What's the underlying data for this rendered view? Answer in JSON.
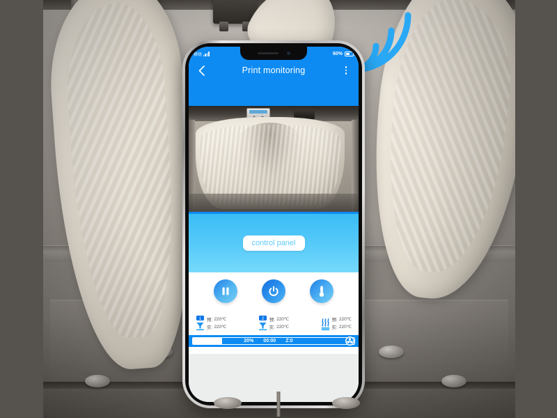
{
  "scene": {
    "description": "3D printer chamber with white printed dragon models",
    "background_bar_color": "#56524e"
  },
  "wifi": {
    "icon": "wifi-signal-icon",
    "color": "#29A8F5",
    "arc_count": 3
  },
  "phone": {
    "status_bar": {
      "carrier": "移动",
      "signal_icon": "signal-bars-icon",
      "battery_percent": "60%",
      "battery_icon": "battery-icon",
      "bg_color": "#0d8bf2"
    },
    "title_bar": {
      "back_icon": "back-chevron-icon",
      "title": "Print monitoring",
      "menu_icon": "more-vertical-icon"
    },
    "camera": {
      "name": "live-camera-feed",
      "subject": "3D printed dragon model in printer"
    },
    "panel": {
      "control_panel_label": "control panel",
      "gradient_from": "#3abcf6",
      "gradient_to": "#76d9fb"
    },
    "buttons": [
      {
        "name": "pause-button",
        "icon": "pause-icon"
      },
      {
        "name": "power-button",
        "icon": "power-icon"
      },
      {
        "name": "temperature-button",
        "icon": "thermometer-icon"
      }
    ],
    "temperatures": [
      {
        "icon": "nozzle-1-icon",
        "target_label": "预:",
        "target_value": "220℃",
        "actual_label": "实:",
        "actual_value": "220℃"
      },
      {
        "icon": "nozzle-2-icon",
        "target_label": "预:",
        "target_value": "220℃",
        "actual_label": "实:",
        "actual_value": "220℃"
      },
      {
        "icon": "heated-bed-icon",
        "target_label": "预:",
        "target_value": "220℃",
        "actual_label": "实:",
        "actual_value": "220℃"
      }
    ],
    "progress": {
      "percent_text": "20%",
      "elapsed_time": "00:00",
      "z_height": "Z:0",
      "fan_icon": "fan-icon",
      "bar_color": "#0d8bf2"
    }
  }
}
